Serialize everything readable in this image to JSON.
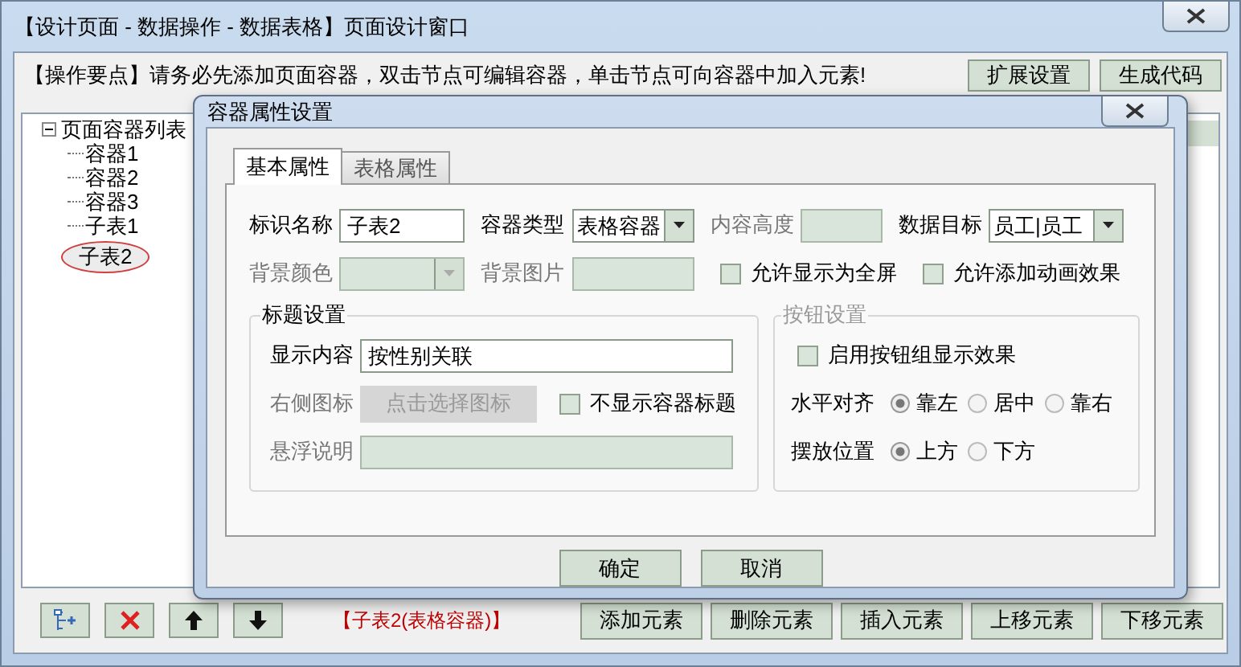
{
  "window": {
    "title": "【设计页面 - 数据操作 - 数据表格】页面设计窗口"
  },
  "hint": "【操作要点】请务必先添加页面容器，双击节点可编辑容器，单击节点可向容器中加入元素!",
  "top_buttons": [
    "扩展设置",
    "生成代码"
  ],
  "tree": {
    "label": "页面容器列表",
    "expanded": true,
    "children": [
      {
        "label": "容器1",
        "selected": false
      },
      {
        "label": "容器2",
        "selected": false
      },
      {
        "label": "容器3",
        "selected": false
      },
      {
        "label": "子表1",
        "selected": false
      },
      {
        "label": "子表2",
        "selected": true
      }
    ]
  },
  "current": "【子表2(表格容器)】",
  "element_buttons": [
    "添加元素",
    "删除元素",
    "插入元素",
    "上移元素",
    "下移元素"
  ],
  "dialog": {
    "title": "容器属性设置",
    "tabs": [
      {
        "label": "基本属性",
        "selected": true
      },
      {
        "label": "表格属性",
        "selected": false
      }
    ],
    "id_name": {
      "label": "标识名称",
      "value": "子表2"
    },
    "container_type": {
      "label": "容器类型",
      "value": "表格容器"
    },
    "content_height": {
      "label": "内容高度",
      "disabled": true
    },
    "data_target": {
      "label": "数据目标",
      "value": "员工|员工"
    },
    "bg_color": {
      "label": "背景颜色",
      "disabled": true
    },
    "bg_image": {
      "label": "背景图片",
      "disabled": true
    },
    "checks": [
      {
        "label": "允许显示为全屏",
        "checked": false
      },
      {
        "label": "允许添加动画效果",
        "checked": false
      }
    ],
    "title_group": {
      "legend": "标题设置",
      "display": {
        "label": "显示内容",
        "value": "按性别关联"
      },
      "icon": {
        "label": "右侧图标",
        "button": "点击选择图标",
        "disabled": true
      },
      "hide_title": {
        "label": "不显示容器标题",
        "checked": false
      },
      "tooltip": {
        "label": "悬浮说明",
        "disabled": true
      }
    },
    "button_group": {
      "legend": "按钮设置",
      "disabled": true,
      "enable": {
        "label": "启用按钮组显示效果",
        "checked": false
      },
      "h_align": {
        "label": "水平对齐",
        "options": [
          {
            "label": "靠左",
            "selected": true
          },
          {
            "label": "居中",
            "selected": false
          },
          {
            "label": "靠右",
            "selected": false
          }
        ]
      },
      "position": {
        "label": "摆放位置",
        "options": [
          {
            "label": "上方",
            "selected": true
          },
          {
            "label": "下方",
            "selected": false
          }
        ]
      }
    },
    "actions": [
      "确定",
      "取消"
    ]
  }
}
